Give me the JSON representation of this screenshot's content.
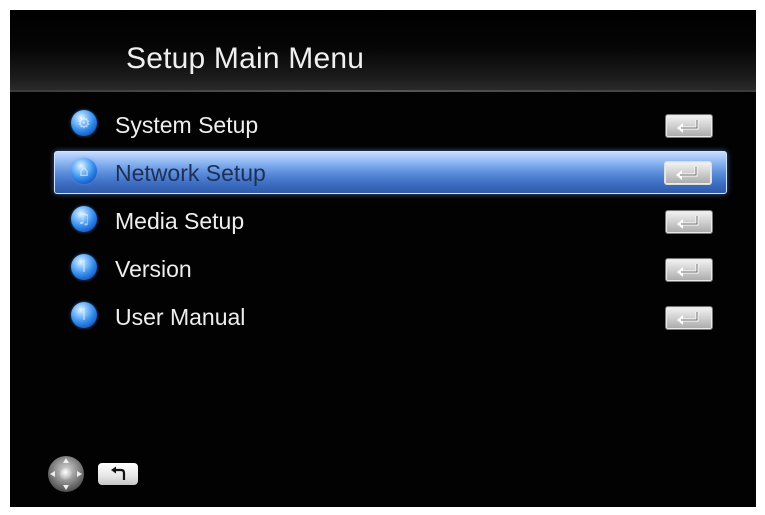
{
  "header": {
    "title": "Setup Main Menu"
  },
  "menu": {
    "selected_index": 1,
    "items": [
      {
        "label": "System Setup",
        "icon": "system-setup-icon",
        "action_icon": "enter-key-icon"
      },
      {
        "label": "Network Setup",
        "icon": "network-setup-icon",
        "action_icon": "enter-key-icon"
      },
      {
        "label": "Media Setup",
        "icon": "media-setup-icon",
        "action_icon": "enter-key-icon"
      },
      {
        "label": "Version",
        "icon": "version-icon",
        "action_icon": "enter-key-icon"
      },
      {
        "label": "User Manual",
        "icon": "user-manual-icon",
        "action_icon": "enter-key-icon"
      }
    ]
  },
  "footer": {
    "nav_icon": "remote-navigation-pad-icon",
    "back_icon": "return-key-icon"
  },
  "colors": {
    "background": "#020202",
    "title_text": "#f0f0f0",
    "item_text": "#eeeeee",
    "selection_highlight": "#5d8fdd",
    "icon_blue": "#2f86ea"
  }
}
